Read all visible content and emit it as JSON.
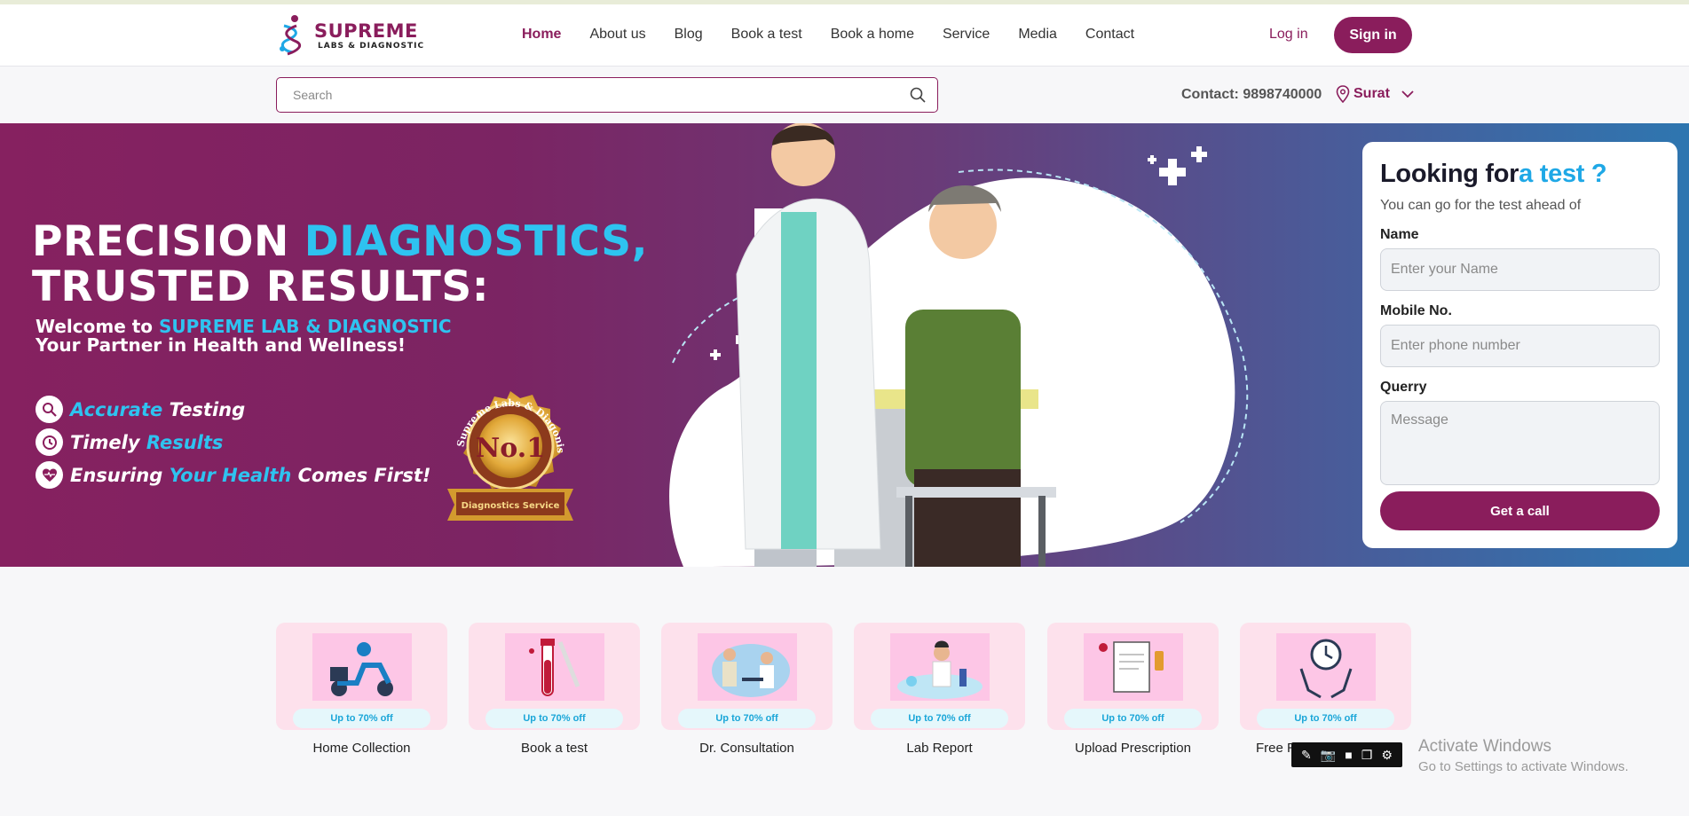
{
  "brand": {
    "name": "SUPREME",
    "tagline": "LABS & DIAGNOSTIC"
  },
  "nav": {
    "items": [
      "Home",
      "About us",
      "Blog",
      "Book a test",
      "Book a home",
      "Service",
      "Media",
      "Contact"
    ],
    "active": "Home"
  },
  "auth": {
    "login": "Log in",
    "signin": "Sign in"
  },
  "search": {
    "placeholder": "Search"
  },
  "contact": "Contact: 9898740000",
  "city": "Surat",
  "hero": {
    "title_part1": "PRECISION ",
    "title_highlight": "DIAGNOSTICS,",
    "title_line2": "TRUSTED RESULTS:",
    "welcome_prefix": "Welcome to ",
    "welcome_highlight": "SUPREME LAB & DIAGNOSTIC",
    "welcome_line2": "Your Partner in Health and Wellness!",
    "features": [
      {
        "icon": "microscope-icon",
        "a": "Accurate",
        "b": " Testing",
        "a_highlight": true
      },
      {
        "icon": "clock-check-icon",
        "a": "Timely ",
        "b": "Results",
        "a_highlight": false
      },
      {
        "icon": "heart-pulse-icon",
        "a": "Ensuring ",
        "b": "Your Health",
        "c": " Comes First!",
        "a_highlight": false
      }
    ],
    "badge": {
      "ring_text": "Supreme Labs & Diagonistic",
      "center": "No.1",
      "ribbon": "Diagnostics Service"
    }
  },
  "form": {
    "title_prefix": "Looking for",
    "title_highlight": "a test ?",
    "subtitle": "You can go for the test ahead of",
    "name_label": "Name",
    "name_placeholder": "Enter your Name",
    "mobile_label": "Mobile No.",
    "mobile_placeholder": "Enter phone number",
    "query_label": "Querry",
    "query_placeholder": "Message",
    "submit": "Get a call"
  },
  "services": [
    {
      "label": "Home Collection",
      "offer": "Up to 70% off",
      "icon": "scooter-delivery-icon"
    },
    {
      "label": "Book a test",
      "offer": "Up to 70% off",
      "icon": "test-tube-icon"
    },
    {
      "label": "Dr. Consultation",
      "offer": "Up to 70% off",
      "icon": "doctor-consultation-icon"
    },
    {
      "label": "Lab Report",
      "offer": "Up to 70% off",
      "icon": "lab-scientist-icon"
    },
    {
      "label": "Upload Prescription",
      "offer": "Up to 70% off",
      "icon": "prescription-icon"
    },
    {
      "label": "Free R",
      "offer": "Up to 70% off",
      "icon": "hands-clock-icon"
    }
  ],
  "windows_watermark": {
    "line1": "Activate Windows",
    "line2": "Go to Settings to activate Windows."
  },
  "colors": {
    "brand": "#8a1d5c",
    "accent": "#2ec3f0"
  }
}
